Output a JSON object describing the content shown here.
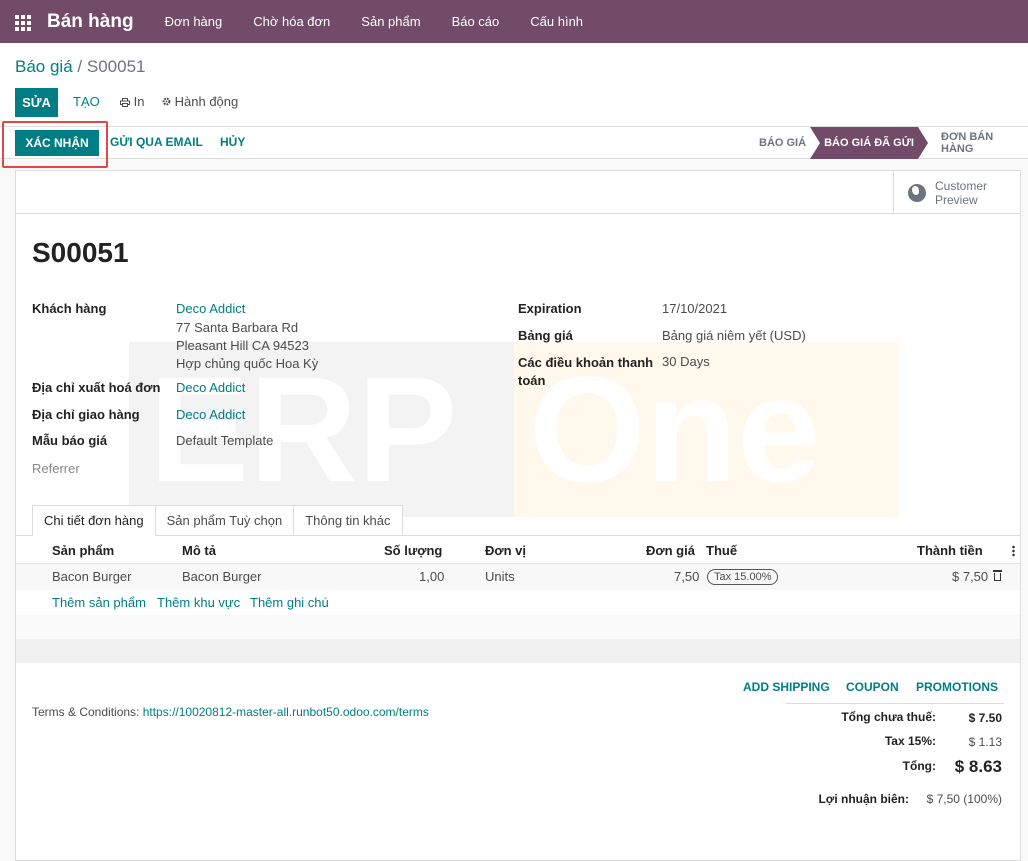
{
  "topbar": {
    "app_name": "Bán hàng",
    "menu": [
      "Đơn hàng",
      "Chờ hóa đơn",
      "Sản phẩm",
      "Báo cáo",
      "Cấu hình"
    ]
  },
  "breadcrumb": {
    "parent": "Báo giá",
    "separator": "/",
    "current": "S00051"
  },
  "control": {
    "edit": "SỬA",
    "create": "TẠO",
    "print": "In",
    "action": "Hành động"
  },
  "status_bar": {
    "confirm": "XÁC NHẬN",
    "send_email": "GỬI QUA EMAIL",
    "cancel": "HỦY",
    "stages": [
      "BÁO GIÁ",
      "BÁO GIÁ ĐÃ GỬI",
      "ĐƠN BÁN HÀNG"
    ],
    "active_stage": "BÁO GIÁ ĐÃ GỬI"
  },
  "preview": {
    "line1": "Customer",
    "line2": "Preview"
  },
  "record": {
    "name": "S00051"
  },
  "fields_left": {
    "customer_label": "Khách hàng",
    "customer_name": "Deco Addict",
    "address_line1": "77 Santa Barbara Rd",
    "address_line2": "Pleasant Hill CA 94523",
    "address_line3": "Hợp chủng quốc Hoa Kỳ",
    "invoice_label": "Địa chỉ xuất hoá đơn",
    "invoice_value": "Deco Addict",
    "delivery_label": "Địa chỉ giao hàng",
    "delivery_value": "Deco Addict",
    "template_label": "Mẫu báo giá",
    "template_value": "Default Template",
    "referrer_label": "Referrer"
  },
  "fields_right": {
    "expiration_label": "Expiration",
    "expiration_value": "17/10/2021",
    "pricelist_label": "Bảng giá",
    "pricelist_value": "Bảng giá niêm yết (USD)",
    "terms_label_1": "Các điều khoản thanh",
    "terms_label_2": "toán",
    "terms_value": "30 Days"
  },
  "watermark": {
    "left": "ERP",
    "right": "One"
  },
  "tabs": [
    "Chi tiết đơn hàng",
    "Sản phẩm Tuỳ chọn",
    "Thông tin khác"
  ],
  "table": {
    "headers": [
      "Sản phẩm",
      "Mô tả",
      "Số lượng",
      "Đơn vị",
      "Đơn giá",
      "Thuế",
      "Thành tiền"
    ],
    "rows": [
      {
        "product": "Bacon Burger",
        "description": "Bacon Burger",
        "qty": "1,00",
        "uom": "Units",
        "price": "7,50",
        "tax": "Tax 15.00%",
        "subtotal": "$ 7,50"
      }
    ],
    "add_links": [
      "Thêm sản phẩm",
      "Thêm khu vực",
      "Thêm ghi chú"
    ]
  },
  "extras": [
    "ADD SHIPPING",
    "COUPON",
    "PROMOTIONS"
  ],
  "terms": {
    "label": "Terms & Conditions:",
    "url": "https://10020812-master-all.runbot50.odoo.com/terms"
  },
  "totals": {
    "untaxed_label": "Tổng chưa thuế:",
    "untaxed_value": "$ 7.50",
    "tax_label": "Tax 15%:",
    "tax_value": "$ 1.13",
    "total_label": "Tổng:",
    "total_value": "$ 8.63",
    "margin_label": "Lợi nhuận biên:",
    "margin_value": "$ 7,50 (100%)"
  },
  "colors": {
    "brand": "#714b67",
    "accent": "#017e84",
    "highlight": "#e04848"
  }
}
